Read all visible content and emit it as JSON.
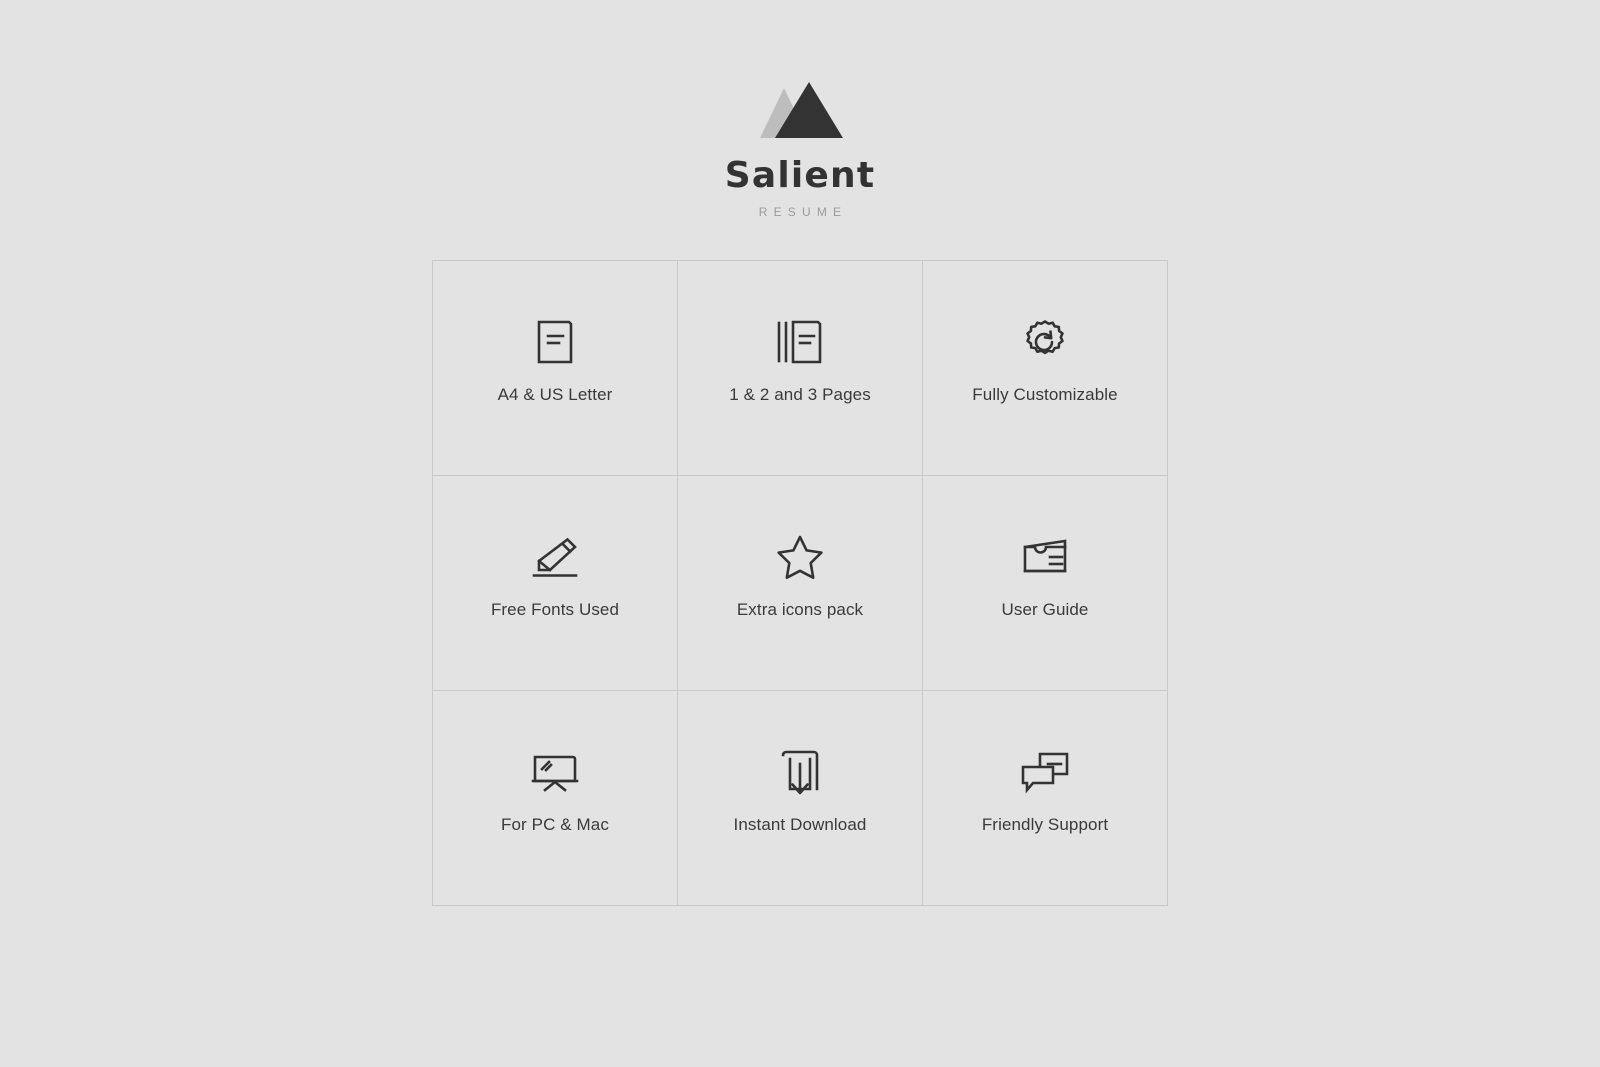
{
  "brand": {
    "name": "Salient",
    "subtitle": "RESUME",
    "logo_icon": "mountain-logo-icon",
    "logo_dark_color": "#333333",
    "logo_light_color": "#bdbdbd"
  },
  "theme": {
    "background": "#e3e3e3",
    "grid_border": "#c9c9c9",
    "text": "#3a3a3a",
    "icon_stroke": "#333333",
    "subtitle_text": "#9b9b9b"
  },
  "features": [
    {
      "label": "A4 & US Letter",
      "icon": "document-page-icon"
    },
    {
      "label": "1 & 2 and 3 Pages",
      "icon": "stacked-pages-icon"
    },
    {
      "label": "Fully Customizable",
      "icon": "gear-refresh-icon"
    },
    {
      "label": "Free Fonts Used",
      "icon": "pencil-writing-icon"
    },
    {
      "label": "Extra icons pack",
      "icon": "star-outline-icon"
    },
    {
      "label": "User Guide",
      "icon": "file-tray-icon"
    },
    {
      "label": "For PC & Mac",
      "icon": "monitor-screen-icon"
    },
    {
      "label": "Instant Download",
      "icon": "download-tray-icon"
    },
    {
      "label": "Friendly Support",
      "icon": "chat-bubbles-icon"
    }
  ]
}
